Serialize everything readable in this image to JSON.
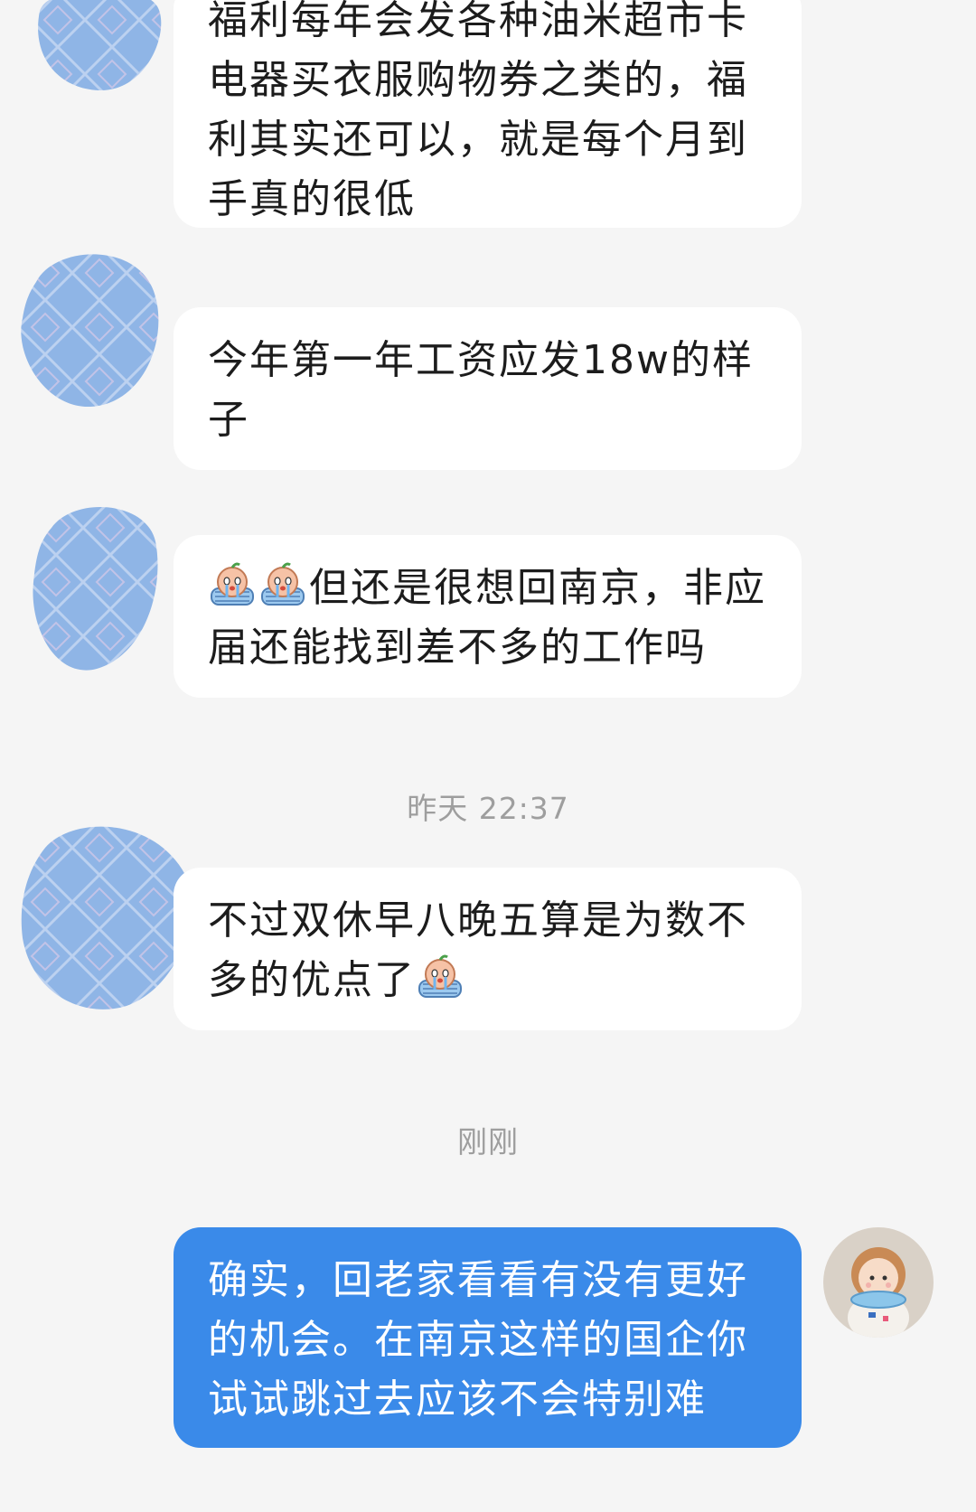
{
  "messages": [
    {
      "text": "福利每年会发各种油米超市卡电器买衣服购物券之类的，福利其实还可以，就是每个月到手真的很低"
    },
    {
      "text": "今年第一年工资应发18w的样子"
    },
    {
      "text": "但还是很想回南京，非应届还能找到差不多的工作吗",
      "emoji_prefix": [
        "crying-baby-emoji",
        "crying-baby-emoji"
      ]
    },
    {
      "text": "不过双休早八晚五算是为数不多的优点了",
      "emoji_suffix": [
        "crying-baby-emoji"
      ]
    },
    {
      "text": "确实，回老家看看有没有更好的机会。在南京这样的国企你试试跳过去应该不会特别难"
    }
  ],
  "timestamps": {
    "yesterday": "昨天 22:37",
    "just_now": "刚刚"
  },
  "colors": {
    "background": "#f5f5f5",
    "incoming_bubble": "#ffffff",
    "outgoing_bubble": "#3a8ae9",
    "redacted_avatar": "#8fb5e6"
  }
}
